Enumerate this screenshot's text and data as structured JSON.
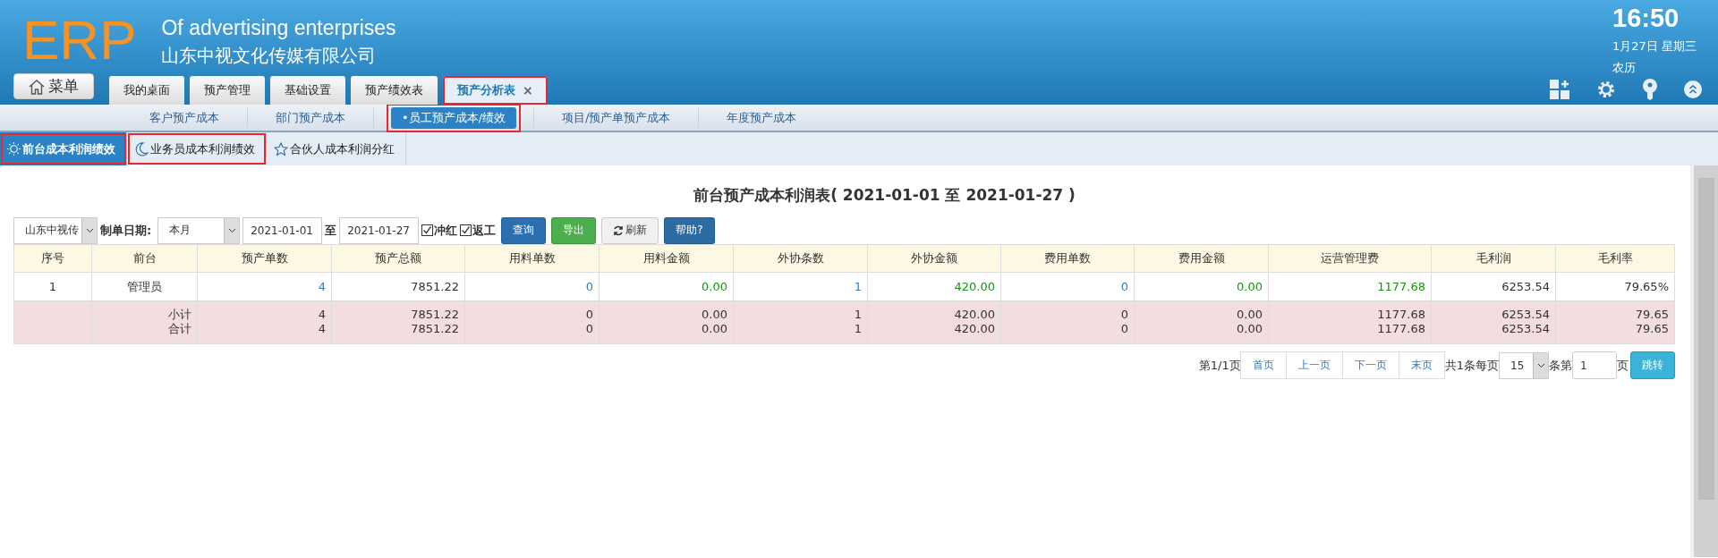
{
  "header": {
    "logo": "ERP",
    "title": "Of advertising enterprises",
    "company": "山东中视文化传媒有限公司",
    "time": "16:50",
    "date": "1月27日 星期三",
    "lunar": "农历"
  },
  "menu_button": "菜单",
  "tabs": [
    {
      "label": "我的桌面",
      "selected": false,
      "highlighted": false
    },
    {
      "label": "预产管理",
      "selected": false,
      "highlighted": false
    },
    {
      "label": "基础设置",
      "selected": false,
      "highlighted": false
    },
    {
      "label": "预产绩效表",
      "selected": false,
      "highlighted": false
    },
    {
      "label": "预产分析表",
      "selected": true,
      "highlighted": true,
      "close": "×"
    }
  ],
  "subnav": [
    {
      "label": "客户预产成本",
      "selected": false,
      "highlighted": false
    },
    {
      "label": "部门预产成本",
      "selected": false,
      "highlighted": false
    },
    {
      "label": "•员工预产成本/绩效",
      "selected": true,
      "highlighted": true
    },
    {
      "label": "项目/预产单预产成本",
      "selected": false,
      "highlighted": false
    },
    {
      "label": "年度预产成本",
      "selected": false,
      "highlighted": false
    }
  ],
  "subtabs": [
    {
      "label": "前台成本利润绩效",
      "selected": true,
      "highlighted": true
    },
    {
      "label": "业务员成本利润绩效",
      "selected": false,
      "highlighted": true
    },
    {
      "label": "合伙人成本利润分红",
      "selected": false,
      "highlighted": false
    }
  ],
  "report_title": "前台预产成本利润表( 2021-01-01 至 2021-01-27 )",
  "filters": {
    "company": "山东中视传",
    "date_label": "制单日期:",
    "period": "本月",
    "start": "2021-01-01",
    "to": "至",
    "end": "2021-01-27",
    "checks": [
      {
        "label": "冲红",
        "checked": true
      },
      {
        "label": "返工",
        "checked": true
      }
    ],
    "buttons": [
      {
        "label": "查询",
        "kind": "primary"
      },
      {
        "label": "导出",
        "kind": "success"
      },
      {
        "label": "刷新",
        "kind": "refresh"
      },
      {
        "label": "帮助?",
        "kind": "dark"
      }
    ]
  },
  "table": {
    "columns": [
      {
        "label": "序号",
        "kind": "center"
      },
      {
        "label": "前台",
        "kind": "center"
      },
      {
        "label": "预产单数",
        "kind": "link"
      },
      {
        "label": "预产总额",
        "kind": "plain"
      },
      {
        "label": "用料单数",
        "kind": "link"
      },
      {
        "label": "用料金额",
        "kind": "money"
      },
      {
        "label": "外协条数",
        "kind": "link"
      },
      {
        "label": "外协金额",
        "kind": "money"
      },
      {
        "label": "费用单数",
        "kind": "link"
      },
      {
        "label": "费用金额",
        "kind": "money"
      },
      {
        "label": "运营管理费",
        "kind": "money"
      },
      {
        "label": "毛利润",
        "kind": "plain"
      },
      {
        "label": "毛利率",
        "kind": "plain"
      }
    ],
    "rows": [
      [
        "1",
        "管理员",
        "4",
        "7851.22",
        "0",
        "0.00",
        "1",
        "420.00",
        "0",
        "0.00",
        "1177.68",
        "6253.54",
        "79.65%"
      ]
    ],
    "summary": [
      {
        "label": "小计",
        "values": [
          "4",
          "7851.22",
          "0",
          "0.00",
          "1",
          "420.00",
          "0",
          "0.00",
          "1177.68",
          "6253.54",
          "79.65"
        ]
      },
      {
        "label": "合计",
        "values": [
          "4",
          "7851.22",
          "0",
          "0.00",
          "1",
          "420.00",
          "0",
          "0.00",
          "1177.68",
          "6253.54",
          "79.65"
        ]
      }
    ]
  },
  "pagination": {
    "page_info": "第1/1页",
    "pages": [
      "首页",
      "上一页",
      "下一页",
      "末页"
    ],
    "total": "共1条每页",
    "per_page": "15",
    "page_prefix": "条第",
    "page": "1",
    "page_suffix": "页",
    "go": "跳转"
  }
}
